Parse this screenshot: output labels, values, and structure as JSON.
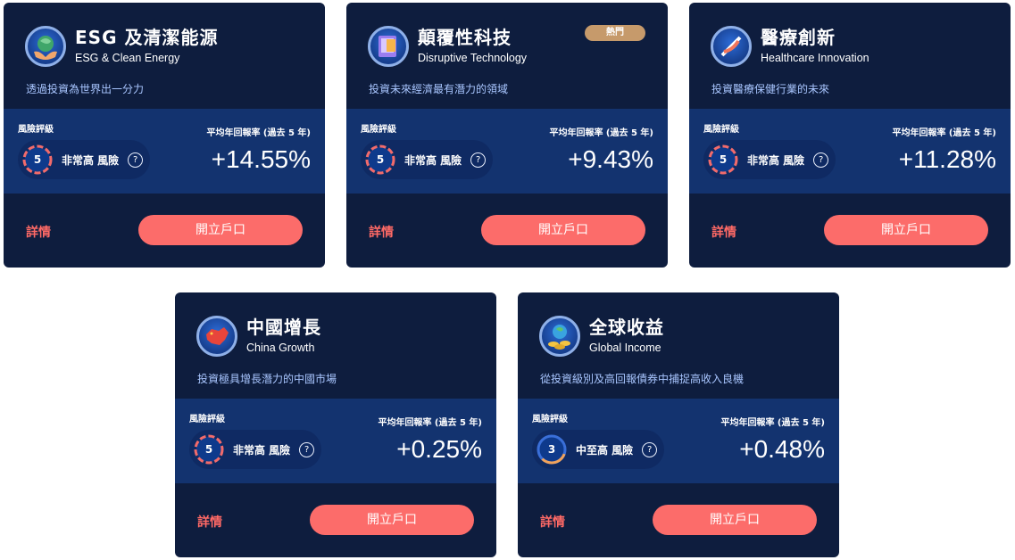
{
  "cards": [
    {
      "title_zh": "ESG 及清潔能源",
      "title_en": "ESG & Clean Energy",
      "description": "透過投資為世界出一分力",
      "risk_label": "風險評級",
      "risk_level": "5",
      "risk_text": "非常高 風險",
      "return_label": "平均年回報率 (過去 5 年)",
      "return_value": "+14.55%",
      "details_label": "詳情",
      "button_label": "開立戶口",
      "icon": "globe-hands-icon"
    },
    {
      "title_zh": "顛覆性科技",
      "title_en": "Disruptive Technology",
      "description": "投資未來經濟最有潛力的領域",
      "badge": "熱門",
      "risk_label": "風險評級",
      "risk_level": "5",
      "risk_text": "非常高 風險",
      "return_label": "平均年回報率 (過去 5 年)",
      "return_value": "+9.43%",
      "details_label": "詳情",
      "button_label": "開立戶口",
      "icon": "tablet-tech-icon"
    },
    {
      "title_zh": "醫療創新",
      "title_en": "Healthcare Innovation",
      "description": "投資醫療保健行業的未來",
      "risk_label": "風險評級",
      "risk_level": "5",
      "risk_text": "非常高 風險",
      "return_label": "平均年回報率 (過去 5 年)",
      "return_value": "+11.28%",
      "details_label": "詳情",
      "button_label": "開立戶口",
      "icon": "dna-icon"
    },
    {
      "title_zh": "中國增長",
      "title_en": "China Growth",
      "description": "投資極具增長潛力的中國市場",
      "risk_label": "風險評級",
      "risk_level": "5",
      "risk_text": "非常高 風險",
      "return_label": "平均年回報率 (過去 5 年)",
      "return_value": "+0.25%",
      "details_label": "詳情",
      "button_label": "開立戶口",
      "icon": "china-map-icon"
    },
    {
      "title_zh": "全球收益",
      "title_en": "Global Income",
      "description": "從投資級別及高回報債券中捕捉高收入良機",
      "risk_label": "風險評級",
      "risk_level": "3",
      "risk_text": "中至高 風險",
      "return_label": "平均年回報率 (過去 5 年)",
      "return_value": "+0.48%",
      "details_label": "詳情",
      "button_label": "開立戶口",
      "icon": "globe-coins-icon"
    }
  ],
  "help_glyph": "?",
  "colors": {
    "card_bg": "#0e1d3e",
    "band_bg": "#13336f",
    "accent_coral": "#fc6c6a",
    "badge": "#c69a6b"
  }
}
